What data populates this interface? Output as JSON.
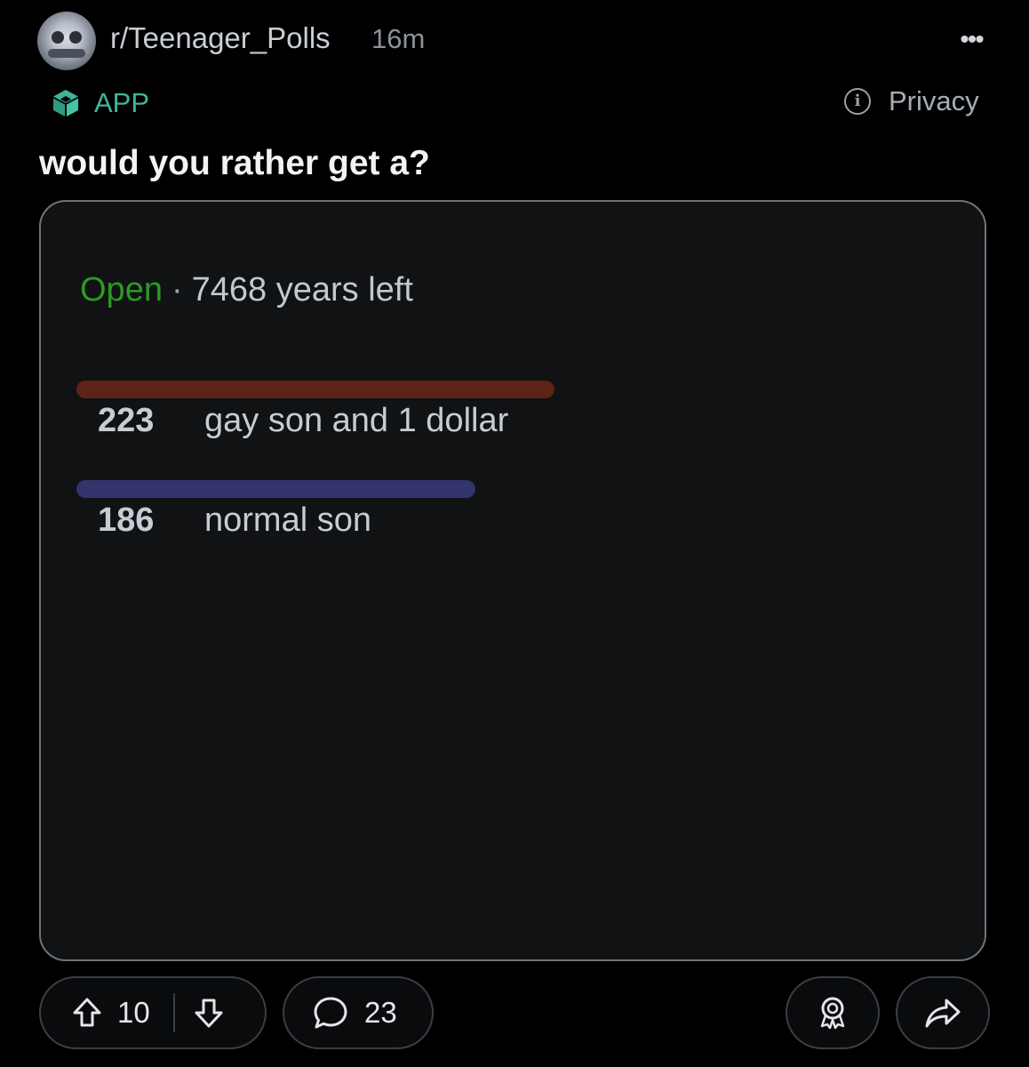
{
  "header": {
    "subreddit": "r/Teenager_Polls",
    "age": "16m",
    "more_icon": "more-horizontal-icon",
    "more_label": "•••",
    "avatar_icon": "subreddit-avatar",
    "app_icon": "cube-icon",
    "app_label": "APP",
    "privacy_icon": "info-icon",
    "privacy_glyph": "i",
    "privacy_label": "Privacy"
  },
  "post": {
    "title": "would you rather get a?"
  },
  "poll": {
    "status": "Open",
    "separator": "·",
    "time_left": "7468 years left",
    "status_color": "#2c9a22",
    "options": [
      {
        "count": "223",
        "votes": 223,
        "label": "gay son and 1 dollar",
        "bar_color": "#5b2417"
      },
      {
        "count": "186",
        "votes": 186,
        "label": "normal son",
        "bar_color": "#33336e"
      }
    ]
  },
  "actions": {
    "upvote_icon": "upvote-arrow-icon",
    "vote_count": "10",
    "downvote_icon": "downvote-arrow-icon",
    "comment_icon": "comment-bubble-icon",
    "comment_count": "23",
    "award_icon": "award-icon",
    "share_icon": "share-arrow-icon"
  },
  "colors": {
    "background": "#000000",
    "card": "#101214",
    "app_accent": "#3fb59a"
  }
}
